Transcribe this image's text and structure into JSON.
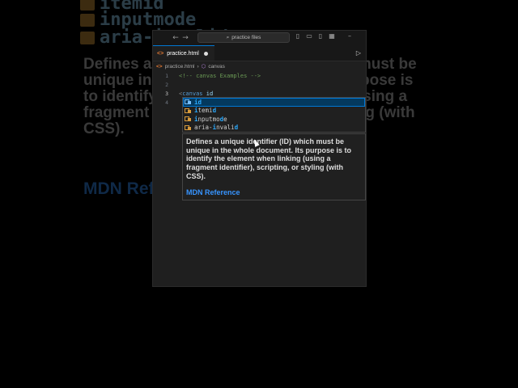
{
  "background_zoom": {
    "suggest_items": [
      "itemid",
      "inputmode",
      "aria-invalid"
    ],
    "doc_lines": [
      "Defines a unique identifier (ID) which must be",
      "unique in the whole document. Its purpose is",
      "to identify the element when linking (using a",
      "fragment identifier), scripting, or styling (with",
      "CSS)."
    ],
    "mdn_label": "MDN Reference"
  },
  "window": {
    "search_placeholder": "practice files",
    "search_icon": "search-icon"
  },
  "tab": {
    "label": "practice.html",
    "file_icon": "<>",
    "modified": true
  },
  "breadcrumb": {
    "file": "practice.html",
    "element": "canvas"
  },
  "code": {
    "line_numbers": [
      "1",
      "2",
      "3",
      "4"
    ],
    "line1": "<!-- canvas Examples -->",
    "line3_tag": "canvas",
    "line3_attr": "id"
  },
  "suggest": {
    "items": [
      {
        "pre": "",
        "match": "id",
        "post": "",
        "selected": true
      },
      {
        "pre": "",
        "match": "i",
        "mid": "temi",
        "match2": "d",
        "post": ""
      },
      {
        "pre": "",
        "match": "i",
        "mid": "nputmo",
        "match2": "d",
        "post": "e"
      },
      {
        "pre": "aria-",
        "match": "i",
        "mid": "nvali",
        "match2": "d",
        "post": ""
      }
    ]
  },
  "doc": {
    "text": "Defines a unique identifier (ID) which must be unique in the whole document. Its purpose is to identify the element when linking (using a fragment identifier), scripting, or styling (with CSS).",
    "link": "MDN Reference"
  },
  "colors": {
    "accent": "#0078d4",
    "link": "#3794ff",
    "match": "#2aaaff",
    "icon_field": "#d89b3c"
  }
}
